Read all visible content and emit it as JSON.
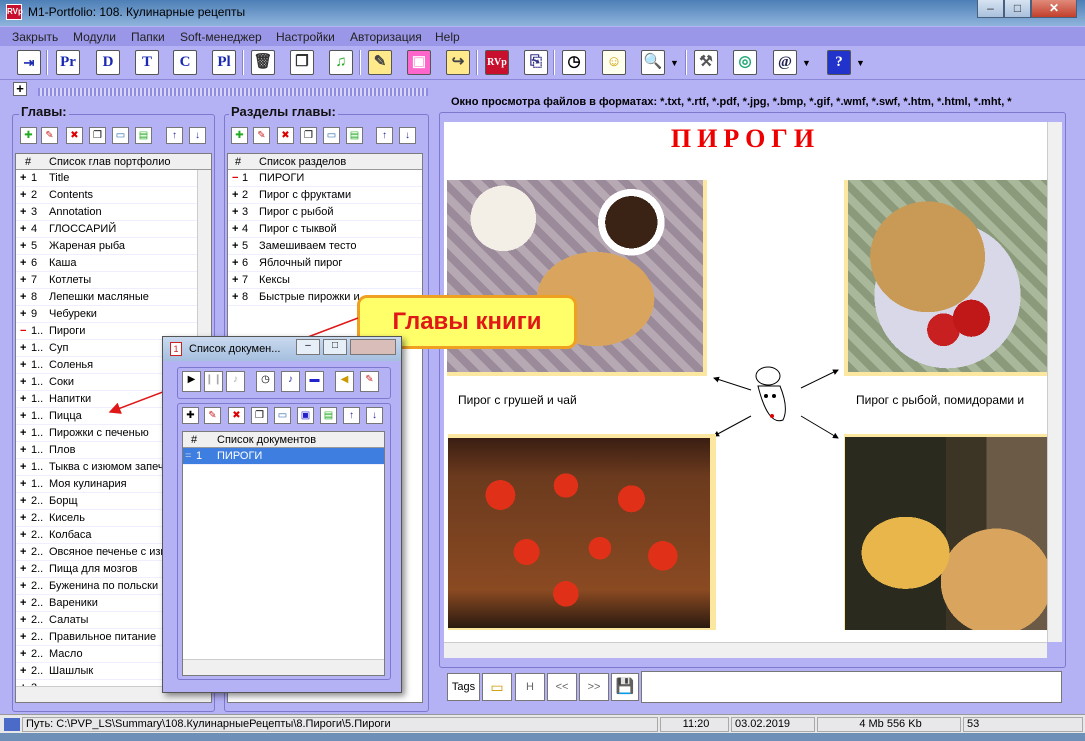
{
  "window": {
    "title": "M1-Portfolio: 108. Кулинарные рецепты",
    "icon": "RVp"
  },
  "menu": [
    "Закрыть",
    "Модули",
    "Папки",
    "Soft-менеджер",
    "Настройки",
    "Авторизация",
    "Help"
  ],
  "toolbar": {
    "letters": [
      "Pr",
      "D",
      "T",
      "C",
      "Pl"
    ]
  },
  "left": {
    "title": "Главы:",
    "column_num": "#",
    "column_name": "Список глав портфолио",
    "items": [
      {
        "mark": "+",
        "num": "1",
        "name": "Title"
      },
      {
        "mark": "+",
        "num": "2",
        "name": "Contents"
      },
      {
        "mark": "+",
        "num": "3",
        "name": "Annotation"
      },
      {
        "mark": "+",
        "num": "4",
        "name": "ГЛОССАРИЙ"
      },
      {
        "mark": "+",
        "num": "5",
        "name": "Жареная рыба"
      },
      {
        "mark": "+",
        "num": "6",
        "name": "Каша"
      },
      {
        "mark": "+",
        "num": "7",
        "name": "Котлеты"
      },
      {
        "mark": "+",
        "num": "8",
        "name": "Лепешки масляные"
      },
      {
        "mark": "+",
        "num": "9",
        "name": "Чебуреки"
      },
      {
        "mark": "−",
        "num": "1..",
        "name": "Пироги"
      },
      {
        "mark": "+",
        "num": "1..",
        "name": "Суп"
      },
      {
        "mark": "+",
        "num": "1..",
        "name": "Соленья"
      },
      {
        "mark": "+",
        "num": "1..",
        "name": "Соки"
      },
      {
        "mark": "+",
        "num": "1..",
        "name": "Напитки"
      },
      {
        "mark": "+",
        "num": "1..",
        "name": "Пицца"
      },
      {
        "mark": "+",
        "num": "1..",
        "name": "Пирожки с печенью"
      },
      {
        "mark": "+",
        "num": "1..",
        "name": "Плов"
      },
      {
        "mark": "+",
        "num": "1..",
        "name": "Тыква с изюмом запеч"
      },
      {
        "mark": "+",
        "num": "1..",
        "name": "Моя кулинария"
      },
      {
        "mark": "+",
        "num": "2..",
        "name": "Борщ"
      },
      {
        "mark": "+",
        "num": "2..",
        "name": "Кисель"
      },
      {
        "mark": "+",
        "num": "2..",
        "name": "Колбаса"
      },
      {
        "mark": "+",
        "num": "2..",
        "name": "Овсяное печенье с изю"
      },
      {
        "mark": "+",
        "num": "2..",
        "name": "Пища для мозгов"
      },
      {
        "mark": "+",
        "num": "2..",
        "name": "Буженина по польски"
      },
      {
        "mark": "+",
        "num": "2..",
        "name": "Вареники"
      },
      {
        "mark": "+",
        "num": "2..",
        "name": "Салаты"
      },
      {
        "mark": "+",
        "num": "2..",
        "name": "Правильное питание"
      },
      {
        "mark": "+",
        "num": "2..",
        "name": "Масло"
      },
      {
        "mark": "+",
        "num": "2..",
        "name": "Шашлык"
      },
      {
        "mark": "+",
        "num": "3..",
        "name": "..."
      }
    ]
  },
  "sections": {
    "title": "Разделы главы:",
    "column_num": "#",
    "column_name": "Список разделов",
    "items": [
      {
        "mark": "−",
        "num": "1",
        "name": "ПИРОГИ"
      },
      {
        "mark": "+",
        "num": "2",
        "name": "Пирог с фруктами"
      },
      {
        "mark": "+",
        "num": "3",
        "name": "Пирог с рыбой"
      },
      {
        "mark": "+",
        "num": "4",
        "name": "Пирог с тыквой"
      },
      {
        "mark": "+",
        "num": "5",
        "name": "Замешиваем тесто"
      },
      {
        "mark": "+",
        "num": "6",
        "name": "Яблочный пирог"
      },
      {
        "mark": "+",
        "num": "7",
        "name": "Кексы"
      },
      {
        "mark": "+",
        "num": "8",
        "name": "Быстрые пирожки и"
      }
    ]
  },
  "viewer": {
    "header": "Окно просмотра файлов в форматах: *.txt, *.rtf, *.pdf, *.jpg, *.bmp, *.gif, *.wmf, *.swf, *.htm, *.html, *.mht, *",
    "doc_title": "ПИРОГИ",
    "caption_left": "Пирог с грушей и чай",
    "caption_right": "Пирог с рыбой, помидорами и",
    "tags_label": "Tags",
    "nav": [
      "H",
      "<<",
      ">>"
    ]
  },
  "callout": "Главы книги",
  "doc_window": {
    "title": "Список докумен...",
    "column_num": "#",
    "column_name": "Список документов",
    "rows": [
      {
        "num": "1",
        "name": "ПИРОГИ"
      }
    ]
  },
  "status": {
    "path": "Путь: C:\\PVP_LS\\Summary\\108.КулинарныеРецепты\\8.Пироги\\5.Пироги",
    "time": "11:20",
    "date": "03.02.2019",
    "size": "4 Mb 556 Kb",
    "count": "53"
  }
}
